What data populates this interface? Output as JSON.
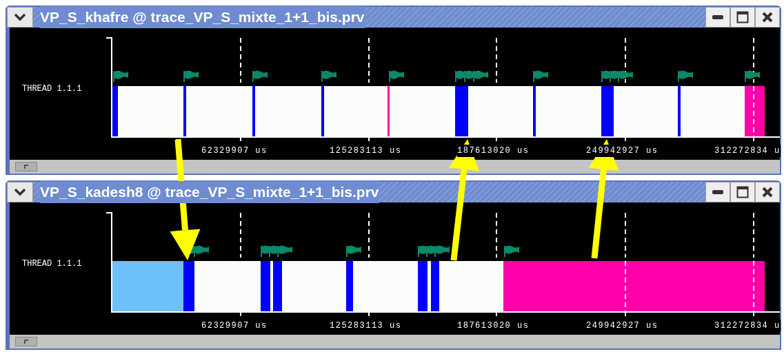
{
  "windows": [
    {
      "title": "VP_S_khafre @ trace_VP_S_mixte_1+1_bis.prv",
      "row_label": "THREAD 1.1.1",
      "time_labels": [
        "62329907 us",
        "125283113 us",
        "187613020 us",
        "249942927 us",
        "312272834 u"
      ]
    },
    {
      "title": "VP_S_kadesh8 @ trace_VP_S_mixte_1+1_bis.prv",
      "row_label": "THREAD 1.1.1",
      "time_labels": [
        "62329907 us",
        "125283113 us",
        "187613020 us",
        "249942927 us",
        "312272834 u"
      ]
    }
  ]
}
